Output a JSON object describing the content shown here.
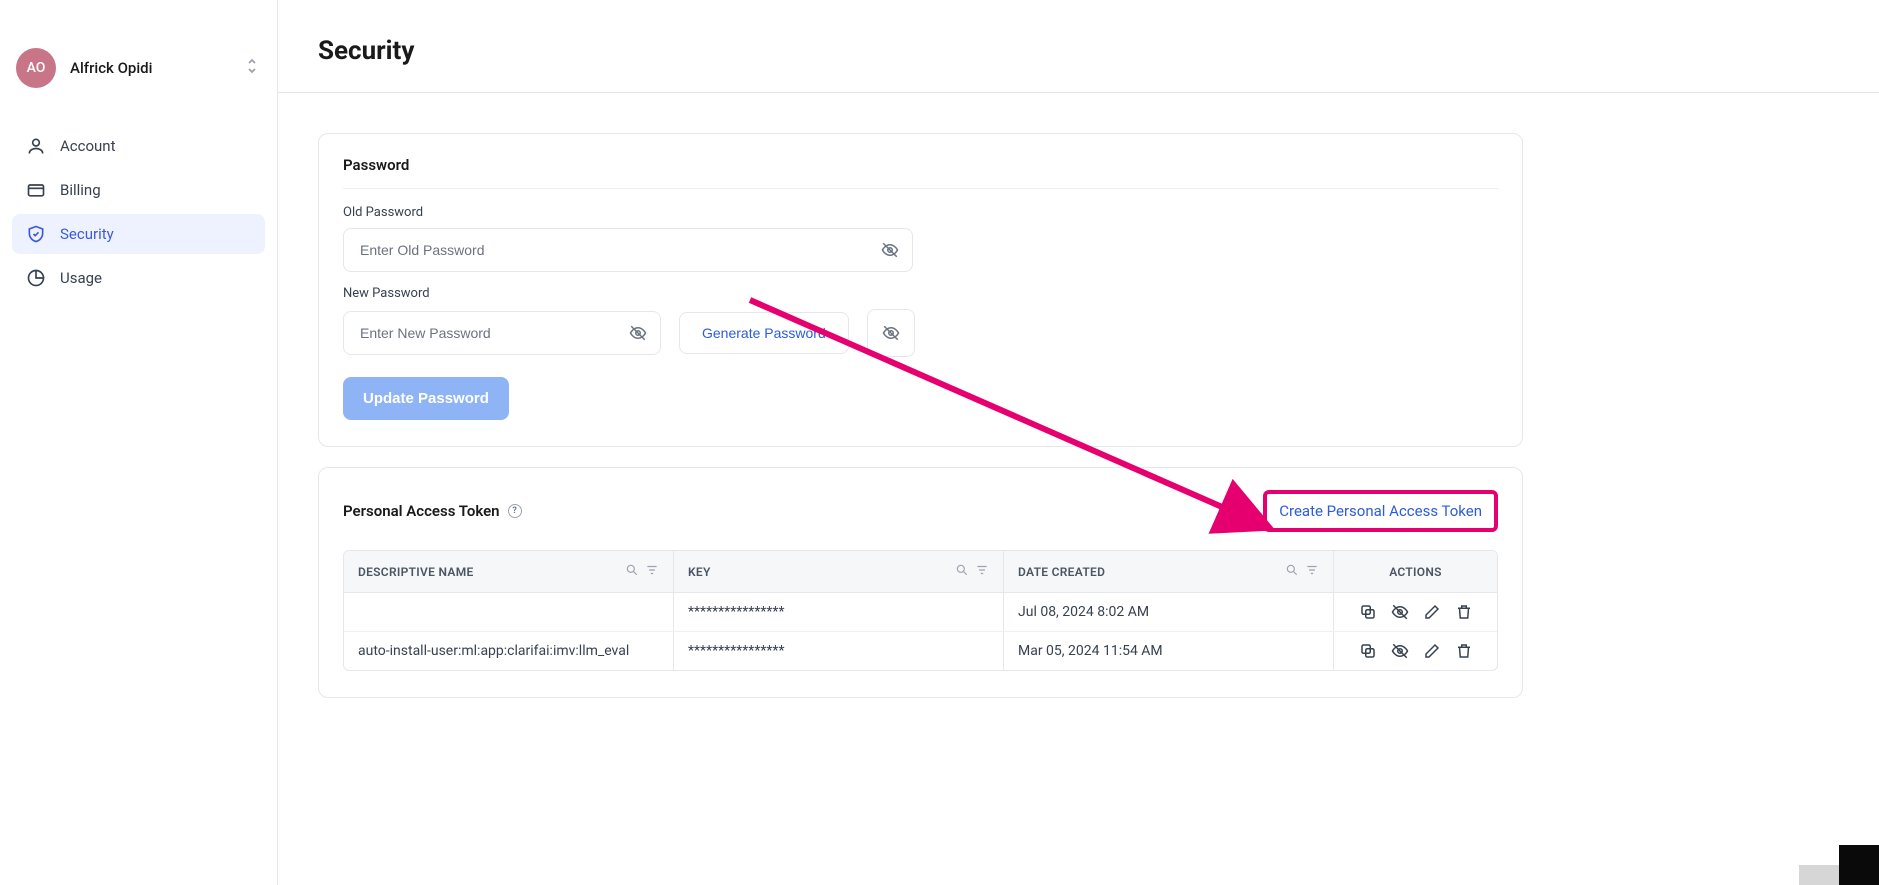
{
  "user": {
    "initials": "AO",
    "name": "Alfrick Opidi"
  },
  "sidebar": {
    "items": [
      {
        "icon": "user-icon",
        "label": "Account"
      },
      {
        "icon": "card-icon",
        "label": "Billing"
      },
      {
        "icon": "shield-icon",
        "label": "Security"
      },
      {
        "icon": "chart-icon",
        "label": "Usage"
      }
    ]
  },
  "page": {
    "title": "Security"
  },
  "password_card": {
    "title": "Password",
    "old_label": "Old Password",
    "old_placeholder": "Enter Old Password",
    "new_label": "New Password",
    "new_placeholder": "Enter New Password",
    "generate_label": "Generate Password",
    "update_label": "Update Password"
  },
  "pat_card": {
    "title": "Personal Access Token",
    "create_label": "Create Personal Access Token",
    "columns": {
      "name": "DESCRIPTIVE NAME",
      "key": "KEY",
      "date": "DATE CREATED",
      "actions": "ACTIONS"
    },
    "rows": [
      {
        "name": "",
        "key": "****************",
        "date": "Jul 08, 2024 8:02 AM"
      },
      {
        "name": "auto-install-user:ml:app:clarifai:imv:llm_eval",
        "key": "****************",
        "date": "Mar 05, 2024 11:54 AM"
      }
    ]
  }
}
